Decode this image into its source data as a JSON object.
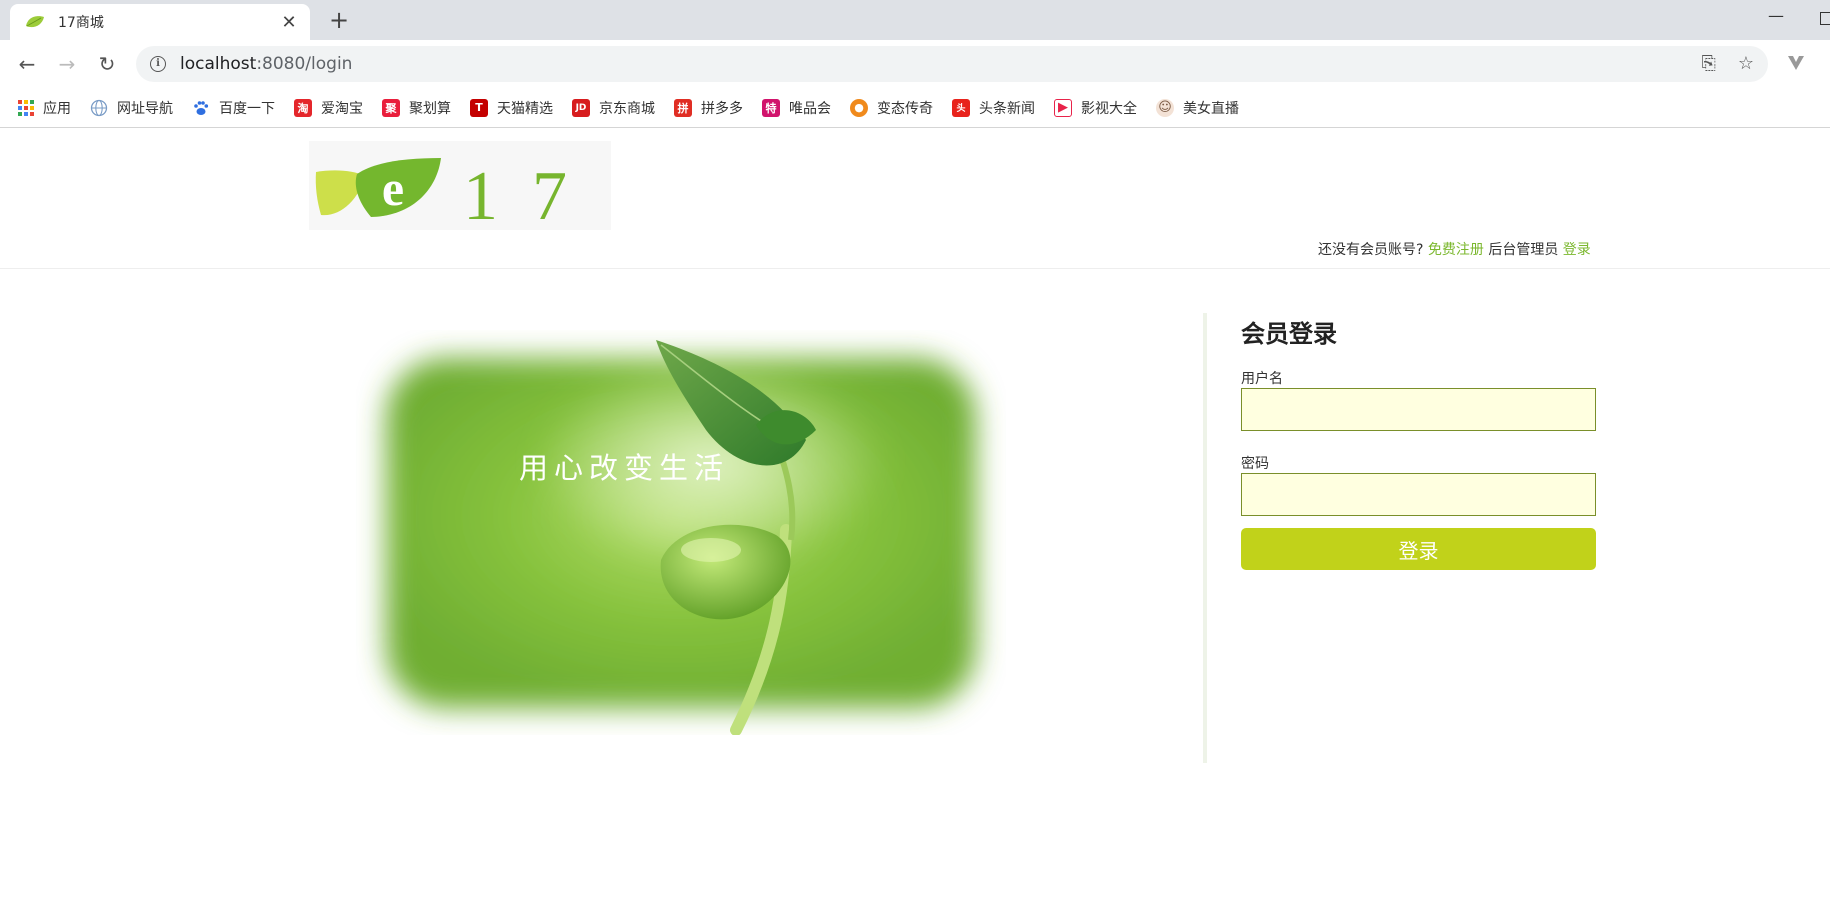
{
  "browser": {
    "tab_title": "17商城",
    "tab_close": "✕",
    "new_tab": "+",
    "url_host": "localhost",
    "url_path": ":8080/login",
    "bookmarks": [
      {
        "label": "应用",
        "icon": "apps-grid-icon"
      },
      {
        "label": "网址导航",
        "icon": "globe-icon"
      },
      {
        "label": "百度一下",
        "icon": "baidu-paw-icon"
      },
      {
        "label": "爱淘宝",
        "icon": "taobao-icon",
        "glyph": "淘",
        "color": "#e4262b"
      },
      {
        "label": "聚划算",
        "icon": "juhuasuan-icon",
        "glyph": "聚",
        "color": "#e91e3c"
      },
      {
        "label": "天猫精选",
        "icon": "tmall-icon",
        "glyph": "T",
        "color": "#c40000"
      },
      {
        "label": "京东商城",
        "icon": "jd-icon",
        "glyph": "JD",
        "color": "#d71c1e"
      },
      {
        "label": "拼多多",
        "icon": "pinduoduo-icon",
        "glyph": "拼",
        "color": "#e02e24"
      },
      {
        "label": "唯品会",
        "icon": "vip-icon",
        "glyph": "特",
        "color": "#d1136c"
      },
      {
        "label": "变态传奇",
        "icon": "legend-game-icon",
        "glyph": "●",
        "color": "#f08a1c"
      },
      {
        "label": "头条新闻",
        "icon": "toutiao-icon",
        "glyph": "头",
        "color": "#e8231c"
      },
      {
        "label": "影视大全",
        "icon": "video-play-icon",
        "glyph": "▶",
        "color": "#e8234a"
      },
      {
        "label": "美女直播",
        "icon": "avatar-icon",
        "glyph": "☺",
        "color": "#b58c6e"
      }
    ]
  },
  "header": {
    "logo_letter": "e",
    "logo_number": "17",
    "no_account_text": "还没有会员账号?",
    "register_link": "免费注册",
    "admin_text": "后台管理员",
    "admin_login_link": "登录"
  },
  "hero": {
    "slogan": "用心改变生活"
  },
  "login": {
    "title": "会员登录",
    "username_label": "用户名",
    "username_value": "",
    "password_label": "密码",
    "password_value": "",
    "submit_label": "登录"
  },
  "colors": {
    "brand_green": "#7cb82f",
    "button_lime": "#c1d21a",
    "input_bg": "#ffffe0"
  }
}
